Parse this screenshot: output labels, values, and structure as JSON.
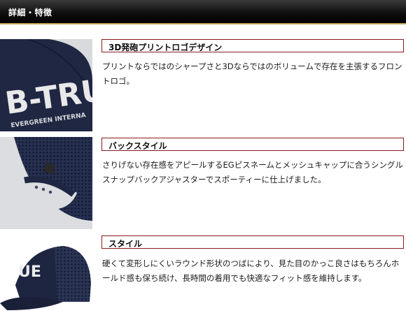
{
  "header": {
    "title": "詳細・特徴"
  },
  "features": [
    {
      "title": "3D発砲プリントロゴデザイン",
      "description": "プリントならではのシャープさと3Dならではのボリュームで存在を主張するフロントロゴ。",
      "image_text": "B-TRU",
      "image_subtext": "EVERGREEN INTERNA"
    },
    {
      "title": "バックスタイル",
      "description": "さりげない存在感をアピールするEGピスネームとメッシュキャップに合うシングルスナップバックアジャスターでスポーティーに仕上げました。"
    },
    {
      "title": "スタイル",
      "description": "硬くて変形しにくいラウンド形状のつばにより、見た目のかっこ良さはもちろんホールド感も保ち続け、長時間の着用でも快適なフィット感を維持します。",
      "image_text": "UE"
    }
  ],
  "colors": {
    "title_border": "#8b1a1a",
    "header_bg": "#000000",
    "header_accent": "#c2a35a",
    "cap_navy": "#1e2540"
  }
}
